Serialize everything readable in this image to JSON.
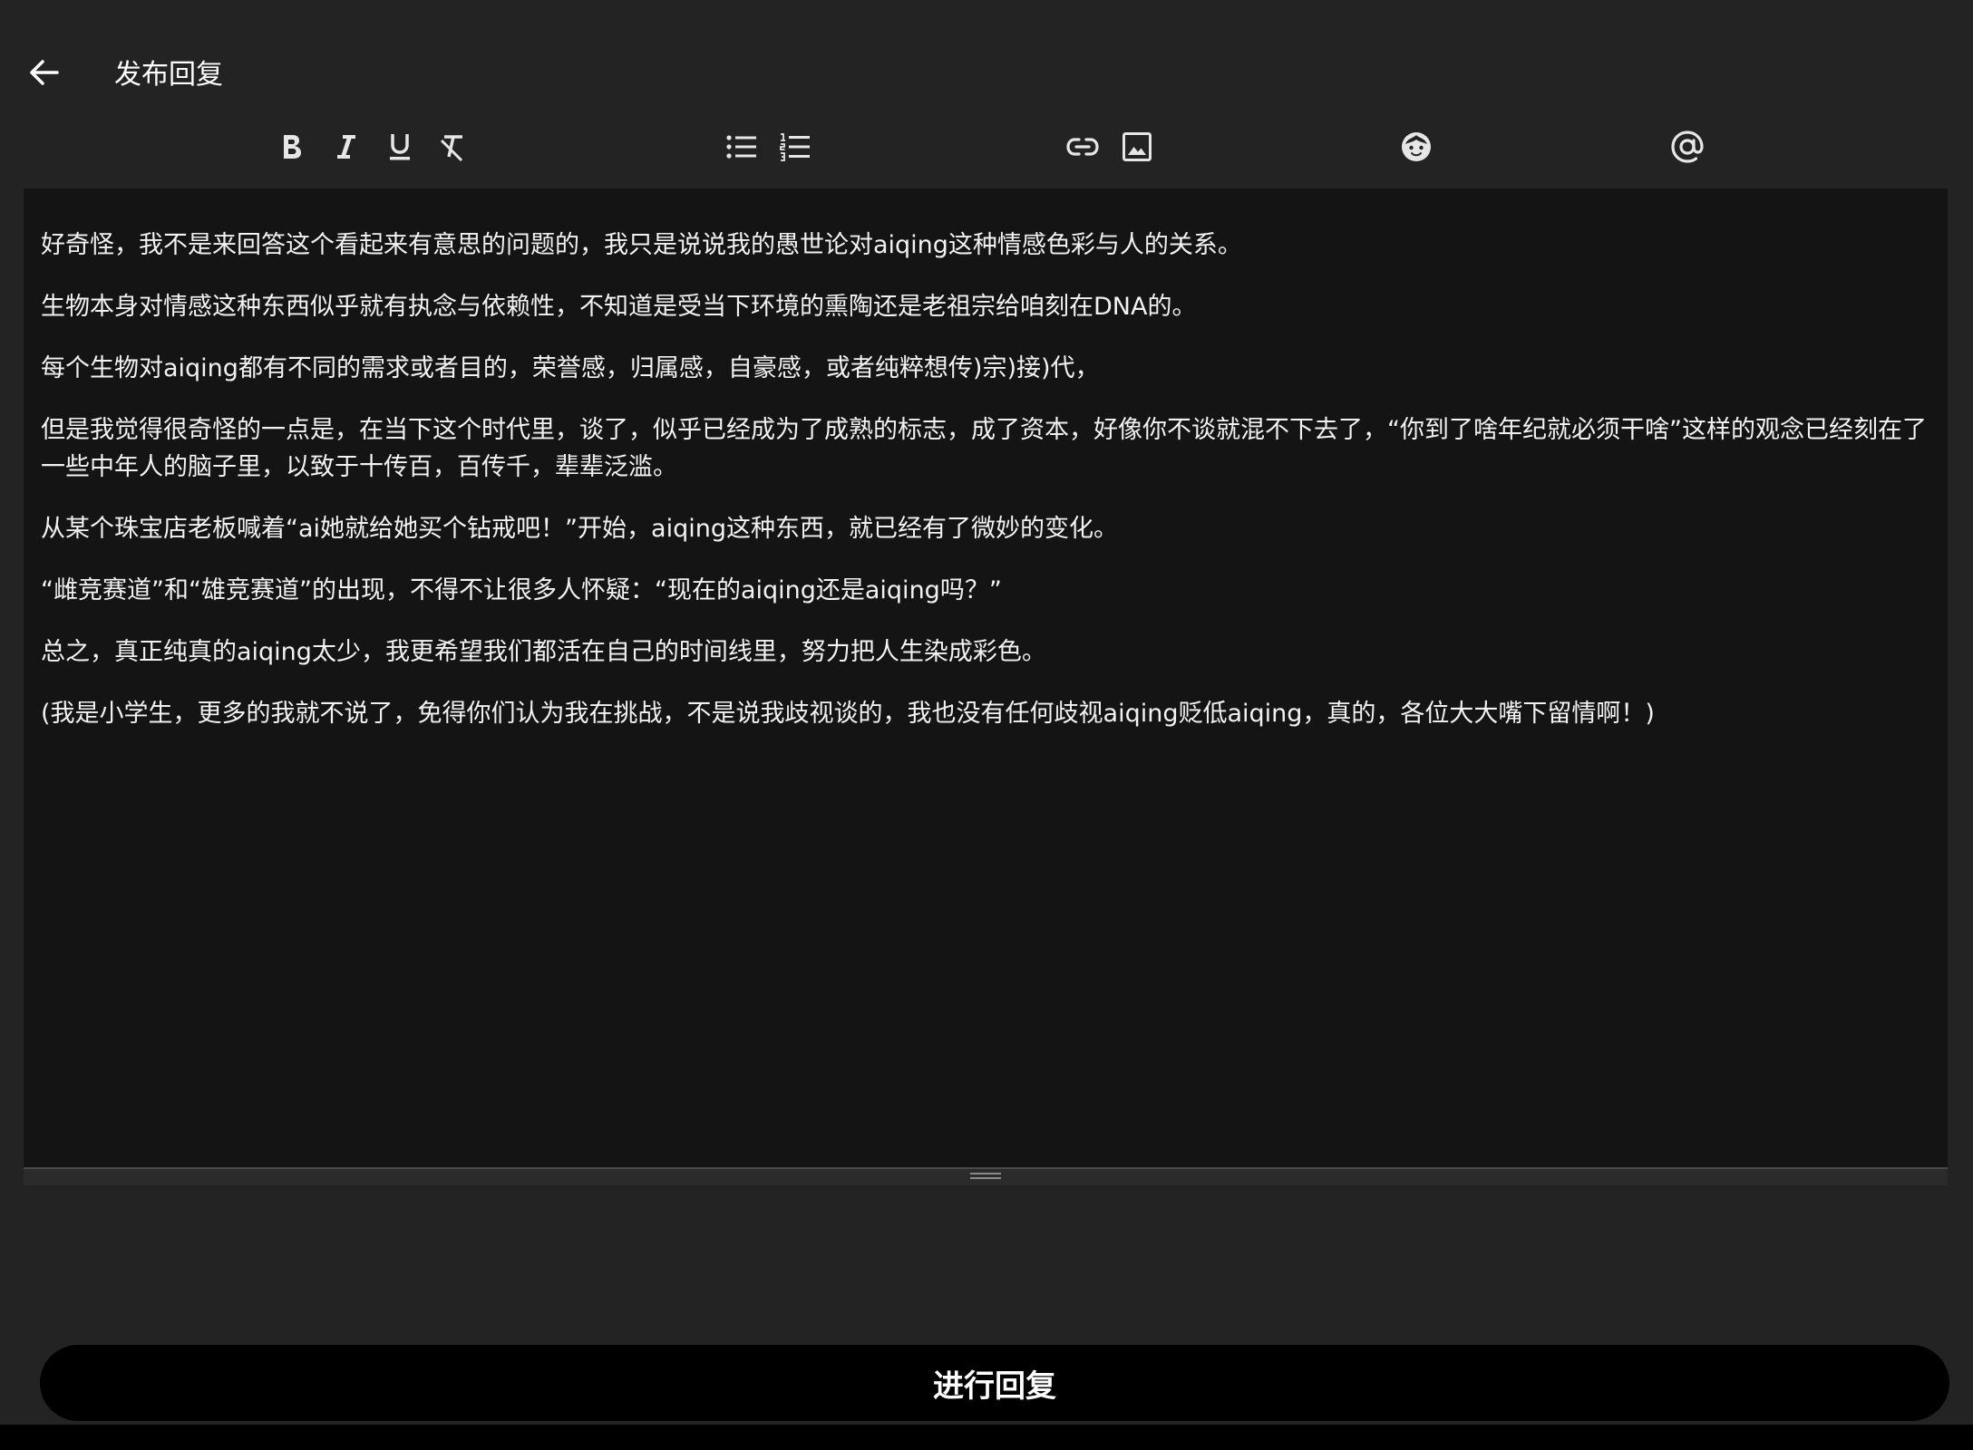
{
  "header": {
    "title": "发布回复",
    "back_icon": "arrow-left-icon"
  },
  "toolbar": {
    "icons": [
      "bold-icon",
      "italic-icon",
      "underline-icon",
      "clear-format-icon",
      "bullet-list-icon",
      "numbered-list-icon",
      "link-icon",
      "image-icon",
      "emoji-icon",
      "mention-icon"
    ]
  },
  "editor": {
    "paragraphs": [
      "好奇怪，我不是来回答这个看起来有意思的问题的，我只是说说我的愚世论对aiqing这种情感色彩与人的关系。",
      "生物本身对情感这种东西似乎就有执念与依赖性，不知道是受当下环境的熏陶还是老祖宗给咱刻在DNA的。",
      "每个生物对aiqing都有不同的需求或者目的，荣誉感，归属感，自豪感，或者纯粹想传)宗)接)代，",
      "但是我觉得很奇怪的一点是，在当下这个时代里，谈了，似乎已经成为了成熟的标志，成了资本，好像你不谈就混不下去了，“你到了啥年纪就必须干啥”这样的观念已经刻在了一些中年人的脑子里，以致于十传百，百传千，辈辈泛滥。",
      "从某个珠宝店老板喊着“ai她就给她买个钻戒吧！”开始，aiqing这种东西，就已经有了微妙的变化。",
      "“雌竞赛道”和“雄竞赛道”的出现，不得不让很多人怀疑：“现在的aiqing还是aiqing吗？”",
      "总之，真正纯真的aiqing太少，我更希望我们都活在自己的时间线里，努力把人生染成彩色。",
      "(我是小学生，更多的我就不说了，免得你们认为我在挑战，不是说我歧视谈的，我也没有任何歧视aiqing贬低aiqing，真的，各位大大嘴下留情啊！)"
    ]
  },
  "submit": {
    "label": "进行回复"
  },
  "colors": {
    "background": "#232323",
    "editor_background": "#141414",
    "button_background": "#000000",
    "text": "#ffffff"
  }
}
